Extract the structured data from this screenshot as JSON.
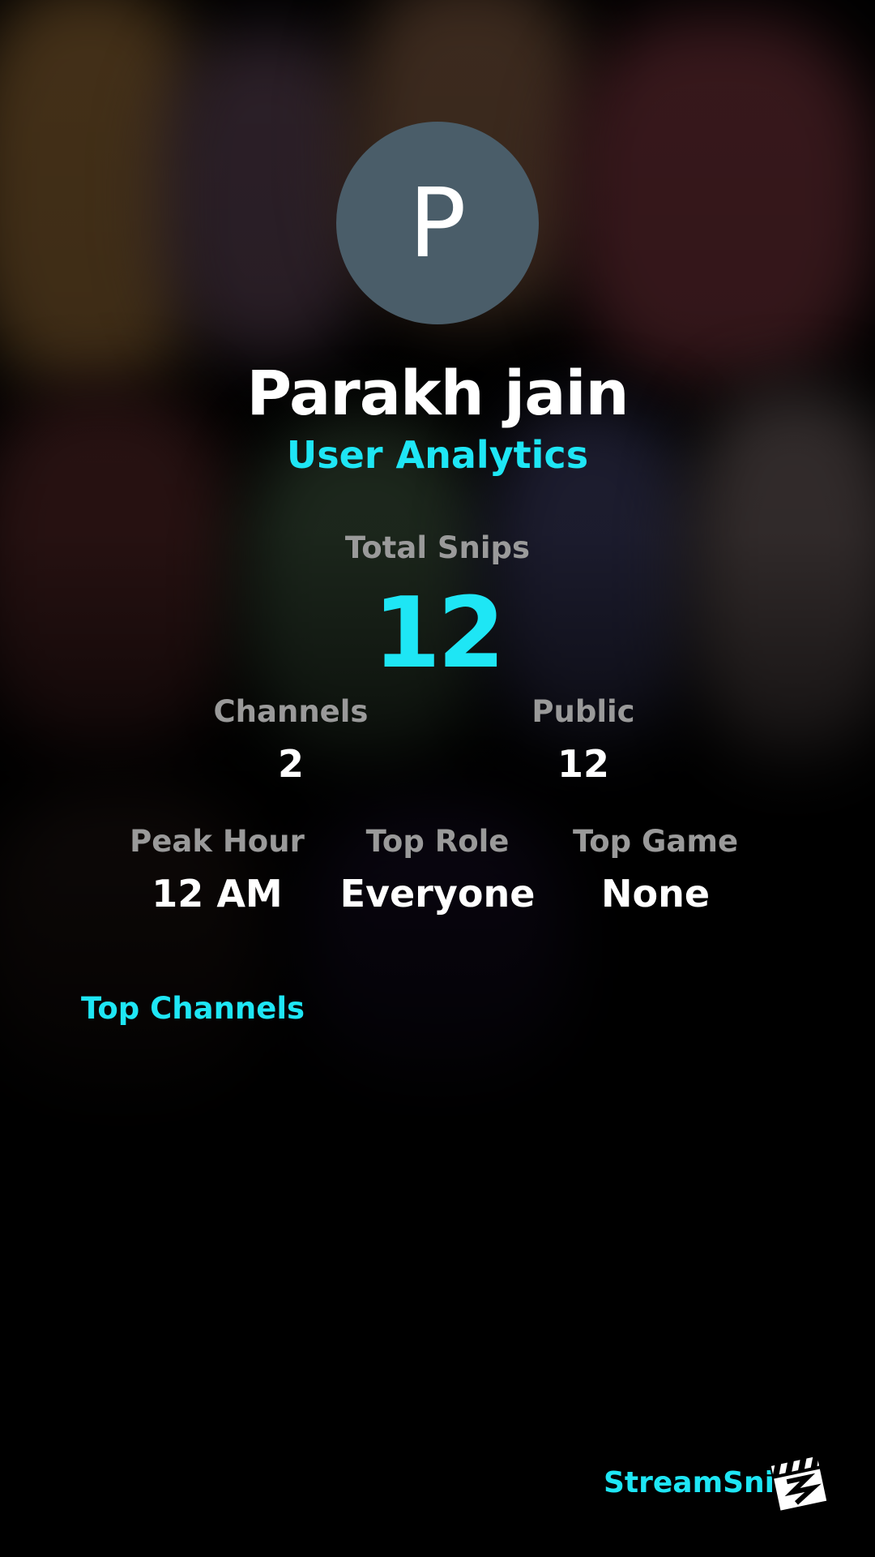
{
  "profile": {
    "avatar_initial": "P",
    "name": "Parakh jain",
    "subtitle": "User Analytics"
  },
  "total": {
    "label": "Total Snips",
    "value": "12"
  },
  "stats_row1": [
    {
      "label": "Channels",
      "value": "2"
    },
    {
      "label": "Public",
      "value": "12"
    }
  ],
  "stats_row2": [
    {
      "label": "Peak Hour",
      "value": "12 AM"
    },
    {
      "label": "Top Role",
      "value": "Everyone"
    },
    {
      "label": "Top Game",
      "value": "None"
    }
  ],
  "top_channels": {
    "title": "Top Channels"
  },
  "brand": {
    "name": "StreamSnip",
    "icon": "clapperboard-icon"
  },
  "colors": {
    "accent": "#1ee6f5",
    "avatar_bg": "#4a5d69",
    "muted_label": "#9a9a9a",
    "background": "#000000"
  }
}
